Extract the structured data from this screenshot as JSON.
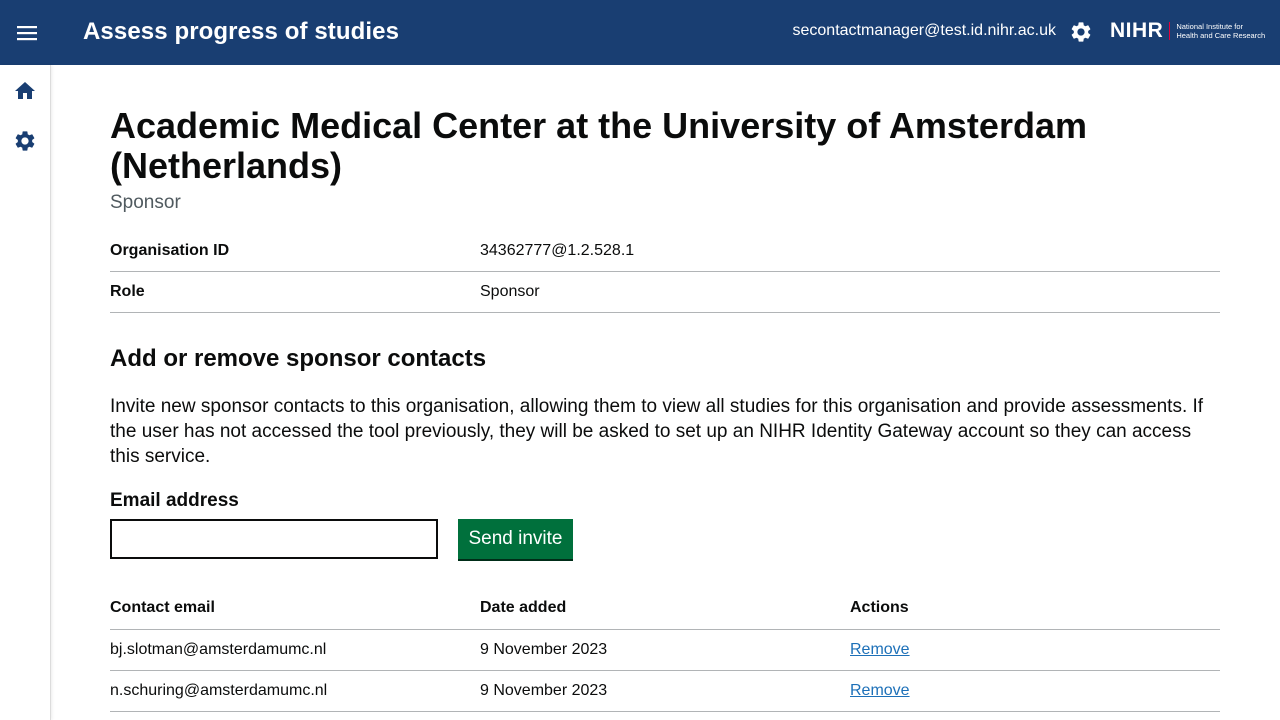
{
  "header": {
    "app_title": "Assess progress of studies",
    "user_email": "secontactmanager@test.id.nihr.ac.uk",
    "logo": {
      "brand": "NIHR",
      "line1": "National Institute for",
      "line2": "Health and Care Research"
    },
    "icons": {
      "menu": "menu-icon",
      "settings": "gear-icon"
    },
    "background_color": "#193e72"
  },
  "sidebar": {
    "items": [
      {
        "icon": "home-icon"
      },
      {
        "icon": "gear-icon"
      }
    ]
  },
  "page": {
    "title": "Academic Medical Center at the University of Amsterdam (Netherlands)",
    "subtitle": "Sponsor",
    "summary": [
      {
        "key": "Organisation ID",
        "value": "34362777@1.2.528.1"
      },
      {
        "key": "Role",
        "value": "Sponsor"
      }
    ],
    "section_title": "Add or remove sponsor contacts",
    "intro": "Invite new sponsor contacts to this organisation, allowing them to view all studies for this organisation and provide assessments. If the user has not accessed the tool previously, they will be asked to set up an NIHR Identity Gateway account so they can access this service.",
    "email_label": "Email address",
    "email_value": "",
    "send_button": "Send invite",
    "send_button_color": "#00703c",
    "table": {
      "headers": [
        "Contact email",
        "Date added",
        "Actions"
      ],
      "rows": [
        {
          "email": "bj.slotman@amsterdamumc.nl",
          "date": "9 November 2023",
          "action": "Remove"
        },
        {
          "email": "n.schuring@amsterdamumc.nl",
          "date": "9 November 2023",
          "action": "Remove"
        }
      ]
    }
  }
}
